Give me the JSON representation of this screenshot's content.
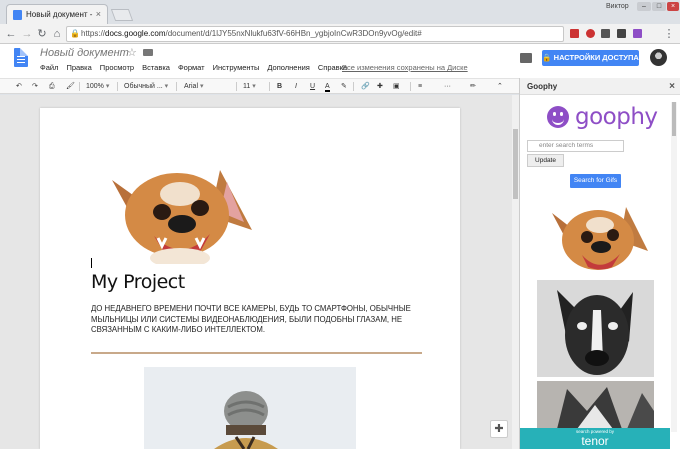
{
  "browser": {
    "tab_title": "Новый документ - ",
    "tab_close": "×",
    "user_label": "Виктор",
    "url_host": "docs.google.com",
    "url_path": "/document/d/1lJY55nxNlukfu63fV-66HBn_ygbjoInCwR3DOn9yvOg/edit#",
    "lock_glyph": "🔒",
    "win_min": "–",
    "win_max": "□",
    "win_close": "×"
  },
  "docs": {
    "title": "Новый документ",
    "star": "☆",
    "menu": [
      "Файл",
      "Правка",
      "Просмотр",
      "Вставка",
      "Формат",
      "Инструменты",
      "Дополнения",
      "Справка"
    ],
    "saved_status": "Все изменения сохранены на Диске",
    "share_label": "🔒 НАСТРОЙКИ ДОСТУПА"
  },
  "toolbar": {
    "zoom": "100%",
    "style": "Обычный ...",
    "font": "Arial",
    "size": "11",
    "bold": "B",
    "italic": "I",
    "underline": "U",
    "text_color": "A",
    "more": "···"
  },
  "document": {
    "heading": "My Project",
    "body": "ДО НЕДАВНЕГО ВРЕМЕНИ ПОЧТИ ВСЕ КАМЕРЫ, БУДЬ ТО СМАРТФОНЫ, ОБЫЧНЫЕ МЫЛЬНИЦЫ ИЛИ СИСТЕМЫ ВИДЕОНАБЛЮДЕНИЯ, БЫЛИ ПОДОБНЫ ГЛАЗАМ, НЕ СВЯЗАННЫМ С КАКИМ-ЛИБО ИНТЕЛЛЕКТОМ."
  },
  "sidebar": {
    "title": "Goophy",
    "close": "×",
    "logo_text": "goophy",
    "search_placeholder": "enter search terms",
    "update_label": "Update",
    "search_button": "Search for Gifs",
    "tenor_small": "search powered by",
    "tenor_brand": "tenor"
  },
  "colors": {
    "accent": "#4285f4",
    "goophy_purple": "#8e4ec6",
    "tenor_teal": "#27b1b8"
  }
}
